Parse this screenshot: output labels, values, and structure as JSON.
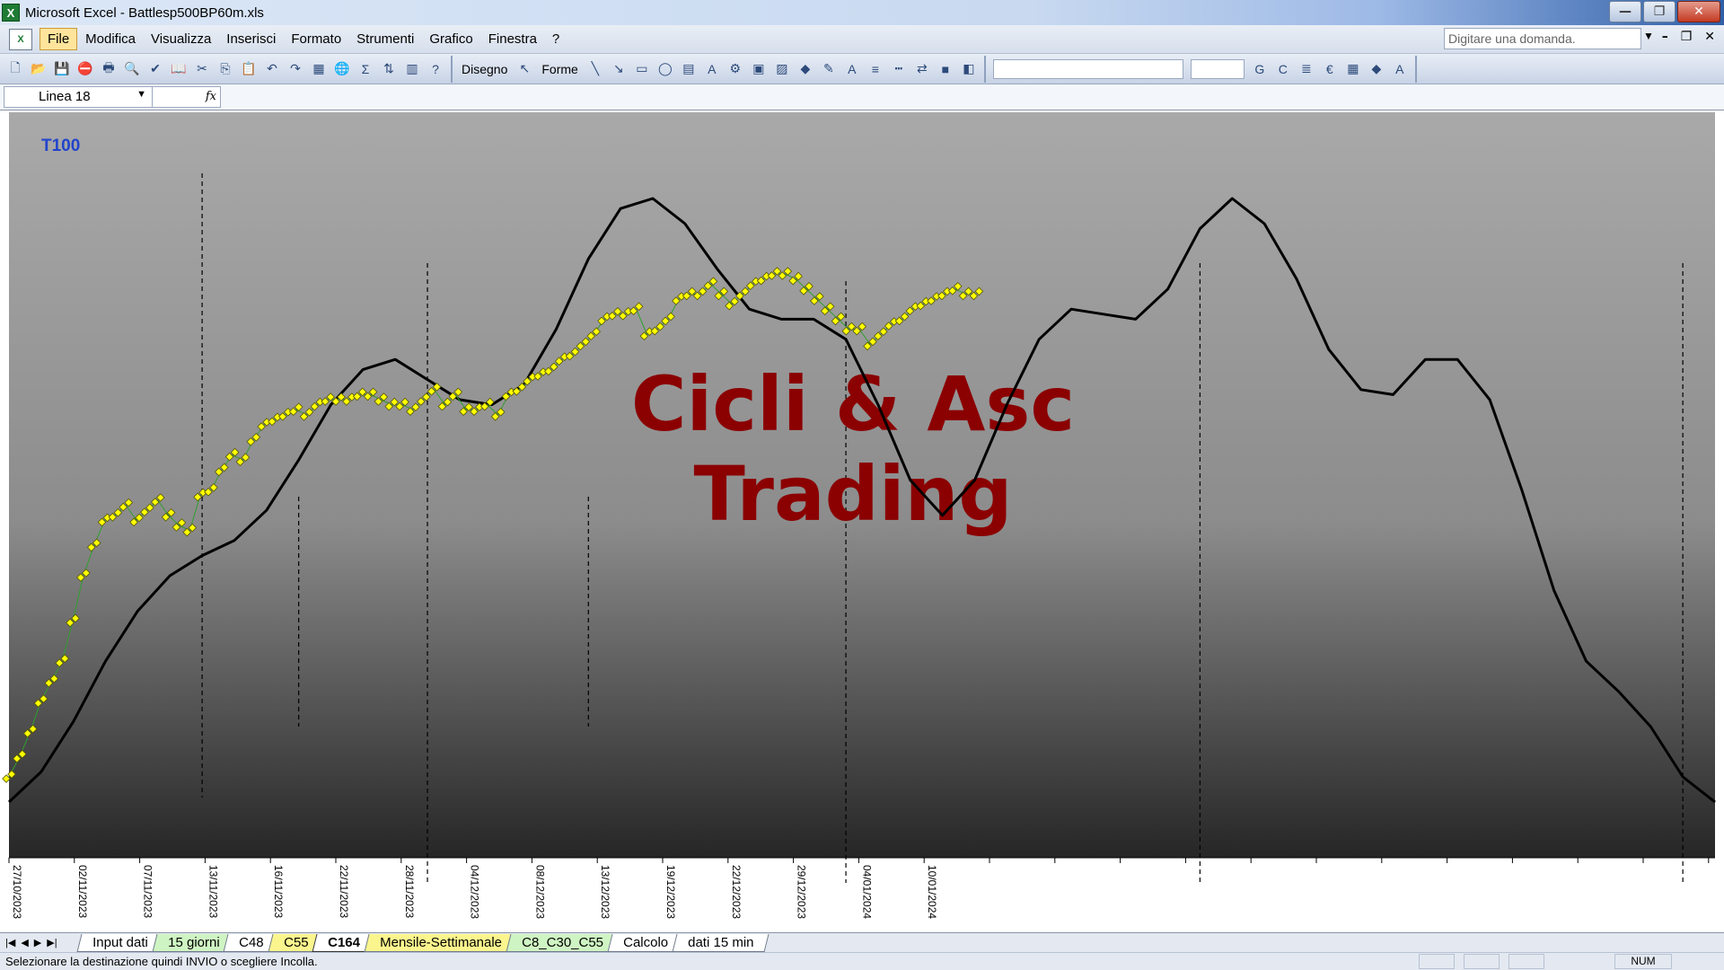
{
  "window": {
    "title": "Microsoft Excel - Battlesp500BP60m.xls",
    "app_icon": "excel-icon"
  },
  "menu": {
    "items": [
      "File",
      "Modifica",
      "Visualizza",
      "Inserisci",
      "Formato",
      "Strumenti",
      "Grafico",
      "Finestra",
      "?"
    ],
    "help_placeholder": "Digitare una domanda."
  },
  "toolbar": {
    "draw_label": "Disegno",
    "shapes_label": "Forme"
  },
  "formula_bar": {
    "name_box": "Linea 18",
    "fx_label": "fx"
  },
  "chart_data": {
    "type": "line",
    "title": "",
    "corner_label": "T100",
    "watermark": [
      "Cicli & Asc",
      "Trading"
    ],
    "x_tick_labels": [
      "27/10/2023",
      "02/11/2023",
      "07/11/2023",
      "13/11/2023",
      "16/11/2023",
      "22/11/2023",
      "28/11/2023",
      "04/12/2023",
      "08/12/2023",
      "13/12/2023",
      "19/12/2023",
      "22/12/2023",
      "29/12/2023",
      "04/01/2024",
      "10/01/2024"
    ],
    "price_series": {
      "name": "",
      "color": "#ffff00",
      "values": [
        5,
        9,
        14,
        20,
        24,
        28,
        36,
        45,
        51,
        56,
        57,
        59,
        56,
        58,
        60,
        57,
        55,
        54,
        61,
        62,
        66,
        69,
        68,
        72,
        75,
        76,
        77,
        78,
        77,
        79,
        80,
        80,
        80,
        81,
        81,
        80,
        79,
        79,
        78,
        80,
        82,
        79,
        81,
        78,
        78,
        79,
        77,
        81,
        82,
        84,
        85,
        86,
        88,
        89,
        91,
        93,
        96,
        97,
        97,
        98,
        93,
        94,
        96,
        100,
        101,
        101,
        103,
        101,
        99,
        101,
        103,
        104,
        105,
        105,
        104,
        102,
        100,
        98,
        96,
        94,
        94,
        91,
        93,
        95,
        96,
        98,
        99,
        100,
        101,
        102,
        101,
        101
      ]
    },
    "cycle_series": {
      "name": "",
      "color": "#000000",
      "values": [
        0,
        6,
        16,
        28,
        38,
        45,
        49,
        52,
        58,
        68,
        79,
        86,
        88,
        84,
        80,
        79,
        83,
        94,
        108,
        118,
        120,
        115,
        106,
        98,
        96,
        96,
        92,
        79,
        64,
        57,
        64,
        79,
        92,
        98,
        97,
        96,
        102,
        114,
        120,
        115,
        104,
        90,
        82,
        81,
        88,
        88,
        80,
        62,
        42,
        28,
        22,
        15,
        5,
        0
      ]
    },
    "y_range": [
      0,
      125
    ],
    "cycle_markers_extended": [
      6,
      13,
      26,
      37,
      52
    ],
    "cycle_markers_short": [
      9,
      18
    ],
    "plot_background": "gradient-grey",
    "grid": false,
    "legend": "none"
  },
  "sheet_tabs": [
    {
      "label": "Input dati",
      "style": "white"
    },
    {
      "label": "15 giorni",
      "style": "green"
    },
    {
      "label": "C48",
      "style": "white"
    },
    {
      "label": "C55",
      "style": "yellow"
    },
    {
      "label": "C164",
      "style": "active"
    },
    {
      "label": "Mensile-Settimanale",
      "style": "yellow"
    },
    {
      "label": "C8_C30_C55",
      "style": "green"
    },
    {
      "label": "Calcolo",
      "style": "white"
    },
    {
      "label": "dati 15 min",
      "style": "white"
    }
  ],
  "status": {
    "message": "Selezionare la destinazione quindi INVIO o scegliere Incolla.",
    "num": "NUM"
  }
}
